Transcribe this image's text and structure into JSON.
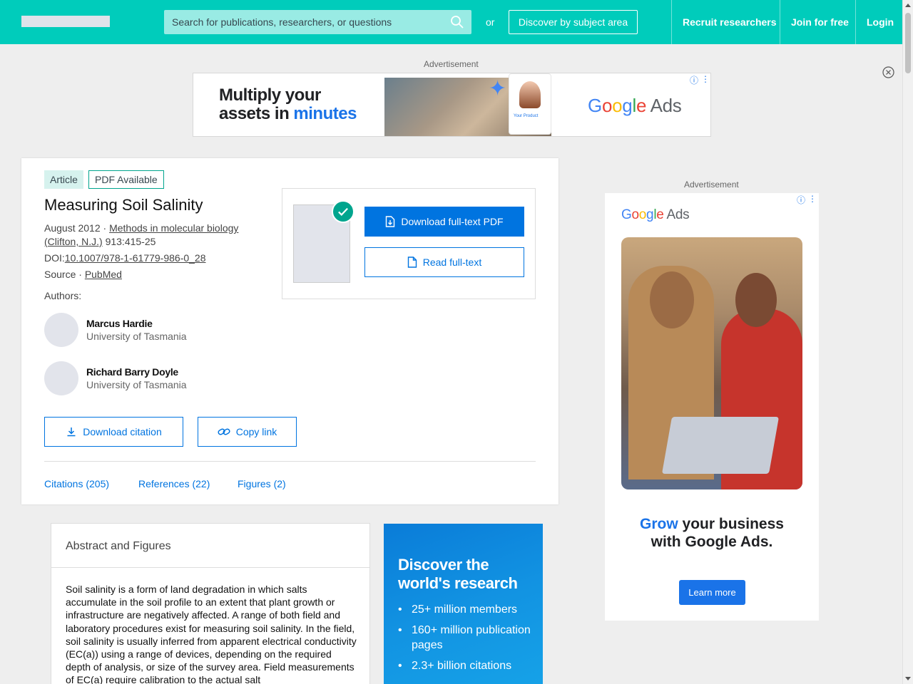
{
  "header": {
    "search_placeholder": "Search for publications, researchers, or questions",
    "or_text": "or",
    "discover_label": "Discover by subject area",
    "recruit_label": "Recruit researchers",
    "join_label": "Join for free",
    "login_label": "Login"
  },
  "ads": {
    "label": "Advertisement",
    "top": {
      "headline_line1": "Multiply your",
      "headline_line2_prefix": "assets in ",
      "headline_line2_highlight": "minutes",
      "card_text": "Your Product",
      "brand": "Google Ads"
    },
    "side": {
      "brand": "Google Ads",
      "headline_highlight": "Grow",
      "headline_rest1": " your business",
      "headline_line2": "with Google Ads.",
      "cta": "Learn more"
    }
  },
  "article": {
    "badge_type": "Article",
    "badge_pdf": "PDF Available",
    "title": "Measuring Soil Salinity",
    "date": "August 2012",
    "journal": "Methods in molecular biology (Clifton, N.J.)",
    "volume_pages": "913:415-25",
    "doi_label": "DOI:",
    "doi": "10.1007/978-1-61779-986-0_28",
    "source_label": "Source · ",
    "source": "PubMed",
    "authors_label": "Authors:",
    "authors": [
      {
        "name": "Marcus Hardie",
        "institution": "University of Tasmania"
      },
      {
        "name": "Richard Barry Doyle",
        "institution": "University of Tasmania"
      }
    ],
    "download_citation": "Download citation",
    "copy_link": "Copy link",
    "download_pdf": "Download full-text PDF",
    "read_fulltext": "Read full-text",
    "tabs": [
      "Citations (205)",
      "References (22)",
      "Figures (2)"
    ]
  },
  "abstract": {
    "heading": "Abstract and Figures",
    "text": "Soil salinity is a form of land degradation in which salts accumulate in the soil profile to an extent that plant growth or infrastructure are negatively affected. A range of both field and laboratory procedures exist for measuring soil salinity. In the field, soil salinity is usually inferred from apparent electrical conductivity (EC(a)) using a range of devices, depending on the required depth of analysis, or size of the survey area. Field measurements of EC(a) require calibration to the actual salt"
  },
  "promo": {
    "title": "Discover the world's research",
    "bullets": [
      "25+ million members",
      "160+ million publication pages",
      "2.3+ billion citations"
    ]
  },
  "colors": {
    "brand_teal": "#00ccbb",
    "link_blue": "#0074e0",
    "pdf_check": "#00a58e"
  }
}
